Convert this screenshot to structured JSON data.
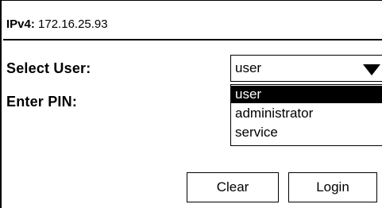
{
  "header": {
    "ip_label": "IPv4:",
    "ip_value": "172.16.25.93"
  },
  "form": {
    "select_user_label": "Select User:",
    "enter_pin_label": "Enter PIN:",
    "user_select": {
      "value": "user",
      "icon": "triangle-down-icon",
      "options": [
        "user",
        "administrator",
        "service"
      ],
      "highlighted_option": "user"
    }
  },
  "actions": {
    "clear_label": "Clear",
    "login_label": "Login"
  }
}
